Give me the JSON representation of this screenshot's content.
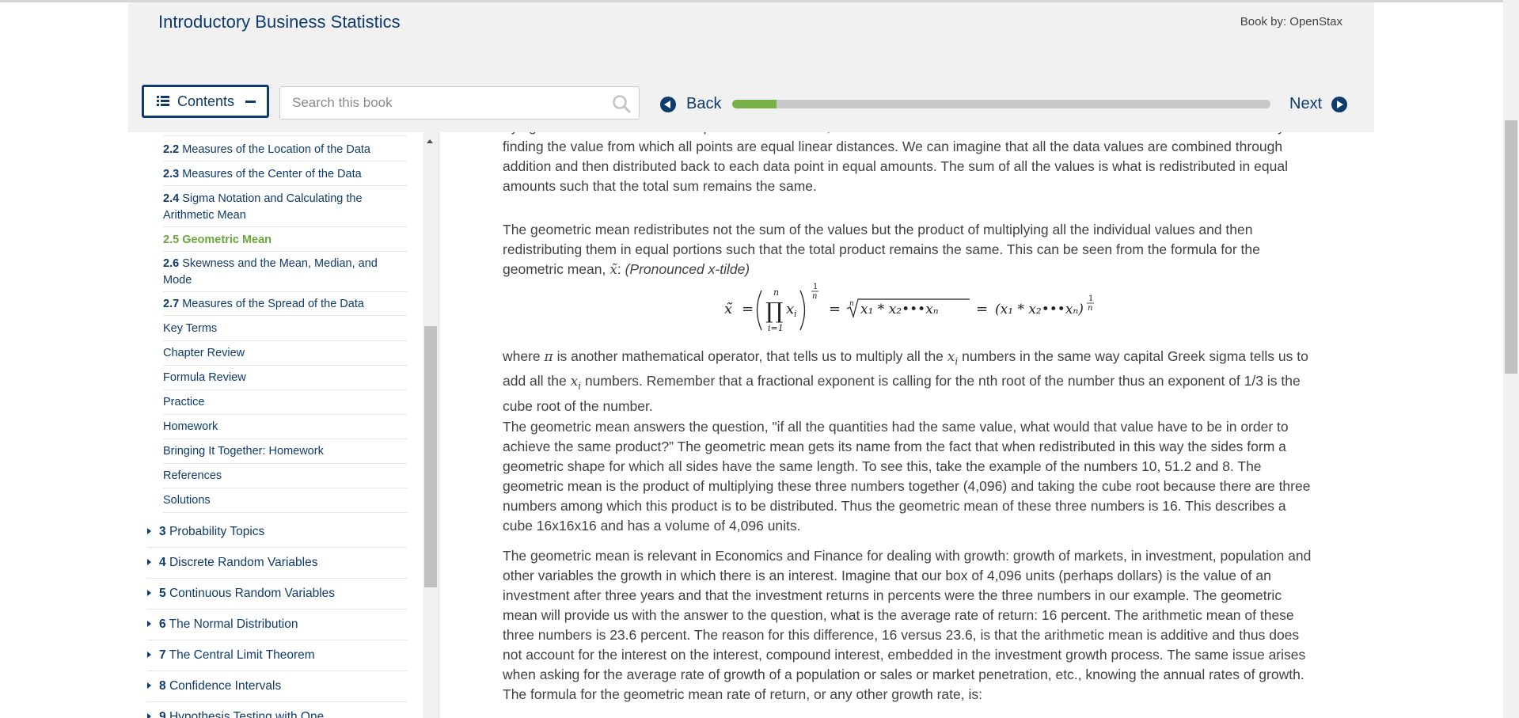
{
  "header": {
    "title": "Introductory Business Statistics",
    "book_by": "Book by: OpenStax",
    "contents_label": "Contents",
    "search_placeholder": "Search this book",
    "back_label": "Back",
    "next_label": "Next",
    "progress_fraction": 0.082
  },
  "sidebar": {
    "sections": [
      {
        "num": "2.2",
        "label": "Measures of the Location of the Data"
      },
      {
        "num": "2.3",
        "label": "Measures of the Center of the Data"
      },
      {
        "num": "2.4",
        "label": "Sigma Notation and Calculating the Arithmetic Mean"
      },
      {
        "num": "2.5",
        "label": "Geometric Mean"
      },
      {
        "num": "2.6",
        "label": "Skewness and the Mean, Median, and Mode"
      },
      {
        "num": "2.7",
        "label": "Measures of the Spread of the Data"
      }
    ],
    "extras": [
      "Key Terms",
      "Chapter Review",
      "Formula Review",
      "Practice",
      "Homework",
      "Bringing It Together: Homework",
      "References",
      "Solutions"
    ],
    "chapters": [
      {
        "num": "3",
        "label": "Probability Topics"
      },
      {
        "num": "4",
        "label": "Discrete Random Variables"
      },
      {
        "num": "5",
        "label": "Continuous Random Variables"
      },
      {
        "num": "6",
        "label": "The Normal Distribution"
      },
      {
        "num": "7",
        "label": "The Central Limit Theorem"
      },
      {
        "num": "8",
        "label": "Confidence Intervals"
      },
      {
        "num": "9",
        "label": "Hypothesis Testing with One"
      }
    ]
  },
  "content": {
    "partial_top": "trying to measure the \"common\" point within the data, that which is \"normal\". In the case of the arithmetic mean this is solved by finding the value from which all points are equal linear distances. We can imagine that all the data values are combined through addition and then distributed back to each data point in equal amounts. The sum of all the values is what is redistributed in equal amounts such that the total sum remains the same.",
    "p1_text": "The geometric mean redistributes not the sum of the values but the product of multiplying all the individual values and then redistributing them in equal portions such that the total product remains the same. This can be seen from the formula for the geometric mean,",
    "p1_var": "x̃",
    "p1_colon": ":",
    "p1_pronounced": "(Pronounced x-tilde)",
    "p2_a": "where",
    "p2_pi": "π",
    "p2_b": "is another mathematical operator, that tells us to multiply all the",
    "p2_xi": "x",
    "p2_i": "i",
    "p2_c": "numbers in the same way capital Greek sigma tells us to add all the",
    "p2_xi2": "x",
    "p2_i2": "i",
    "p2_d": "numbers. Remember that a fractional exponent is calling for the nth root of the number thus an exponent of 1/3 is the cube root of the number.",
    "p3": "The geometric mean answers the question, \"if all the quantities had the same value, what would that value have to be in order to achieve the same product?” The geometric mean gets its name from the fact that when redistributed in this way the sides form a geometric shape for which all sides have the same length. To see this, take the example of the numbers 10, 51.2 and 8. The geometric mean is the product of multiplying these three numbers together (4,096) and taking the cube root because there are three numbers among which this product is to be distributed. Thus the geometric mean of these three numbers is 16. This describes a cube 16x16x16 and has a volume of 4,096 units.",
    "p4": "The geometric mean is relevant in Economics and Finance for dealing with growth: growth of markets, in investment, population and other variables the growth in which there is an interest. Imagine that our box of 4,096 units (perhaps dollars) is the value of an investment after three years and that the investment returns in percents were the three numbers in our example. The geometric mean will provide us with the answer to the question, what is the average rate of return: 16 percent. The arithmetic mean of these three numbers is 23.6 percent. The reason for this difference, 16 versus 23.6, is that the arithmetic mean is additive and thus does not account for the interest on the interest, compound interest, embedded in the investment growth process. The same issue arises when asking for the average rate of growth of a population or sales or market penetration, etc., knowing the annual rates of growth. The formula for the geometric mean rate of return, or any other growth rate, is:"
  },
  "formula": {
    "lhs": "x̃",
    "eq": "=",
    "prod_upper": "n",
    "prod_symbol": "∏",
    "prod_lower": "i=1",
    "prod_var": "x",
    "prod_sub": "i",
    "exp_num": "1",
    "exp_den": "n",
    "root_index": "n",
    "radicand": "x₁ * x₂•••xₙ",
    "rhs": "(x₁ * x₂•••xₙ)"
  },
  "colors": {
    "brand_navy": "#0e3b6e",
    "active_green": "#6aa63a",
    "progress_green": "#78b04a"
  }
}
